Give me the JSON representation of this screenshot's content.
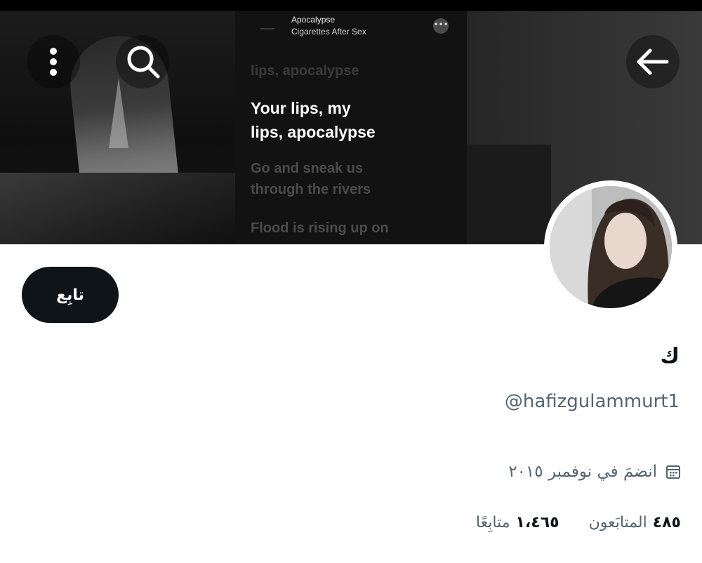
{
  "header": {
    "back_icon": "arrow-left-icon",
    "search_icon": "search-icon",
    "more_icon": "more-vertical-icon"
  },
  "banner": {
    "song_title": "Apocalypse",
    "song_artist": "Cigarettes After Sex",
    "lyric_faded_top": "lips, apocalypse",
    "lyric_main_line1": "Your lips, my",
    "lyric_main_line2": "lips, apocalypse",
    "lyric_next_line1": "Go and sneak us",
    "lyric_next_line2": "through the rivers",
    "lyric_next_line3": "Flood is rising up on"
  },
  "profile": {
    "follow_label": "تابِع",
    "display_name": "ك",
    "handle": "@hafizgulammurt1",
    "joined": "انضمَ في نوفمبر ٢٠١٥",
    "joined_icon": "calendar-icon",
    "followers_count": "٤٨٥",
    "followers_label": "المتابَعون",
    "following_count": "١،٤٦٥",
    "following_label": "متابِعًا"
  },
  "colors": {
    "primary_text": "#0f1419",
    "secondary_text": "#536471",
    "button_bg": "#0f1419"
  }
}
